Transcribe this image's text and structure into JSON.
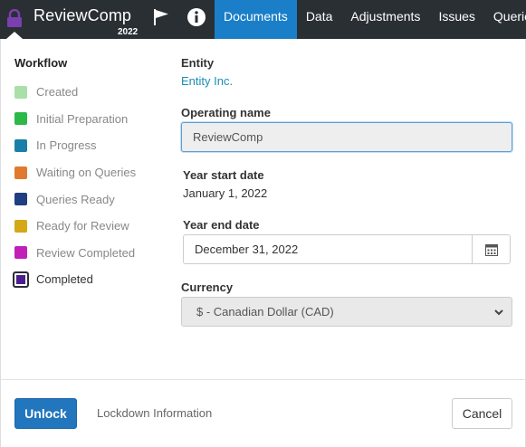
{
  "header": {
    "app_name": "ReviewComp",
    "year": "2022",
    "nav": [
      {
        "label": "Documents",
        "active": true
      },
      {
        "label": "Data"
      },
      {
        "label": "Adjustments"
      },
      {
        "label": "Issues"
      },
      {
        "label": "Queries"
      }
    ],
    "icons": [
      "lock-icon",
      "flag-icon",
      "info-icon"
    ]
  },
  "workflow": {
    "heading": "Workflow",
    "items": [
      {
        "label": "Created",
        "color": "#a8e0a8"
      },
      {
        "label": "Initial Preparation",
        "color": "#2db84a"
      },
      {
        "label": "In Progress",
        "color": "#1a7fa8"
      },
      {
        "label": "Waiting on Queries",
        "color": "#e07a30"
      },
      {
        "label": "Queries Ready",
        "color": "#1f3f80"
      },
      {
        "label": "Ready for Review",
        "color": "#d4a817"
      },
      {
        "label": "Review Completed",
        "color": "#c020b8"
      },
      {
        "label": "Completed",
        "color": "#4a1f8c",
        "current": true
      }
    ]
  },
  "form": {
    "entity_label": "Entity",
    "entity_value": "Entity Inc.",
    "operating_name_label": "Operating name",
    "operating_name_value": "ReviewComp",
    "year_start_label": "Year start date",
    "year_start_value": "January 1, 2022",
    "year_end_label": "Year end date",
    "year_end_value": "December 31, 2022",
    "currency_label": "Currency",
    "currency_value": "$ - Canadian Dollar (CAD)"
  },
  "footer": {
    "unlock_label": "Unlock",
    "lockdown_label": "Lockdown Information",
    "cancel_label": "Cancel"
  },
  "colors": {
    "topbar": "#2a2f34",
    "active_nav": "#1a7fc8",
    "primary_button": "#2176bd",
    "link": "#1a8fb8"
  }
}
